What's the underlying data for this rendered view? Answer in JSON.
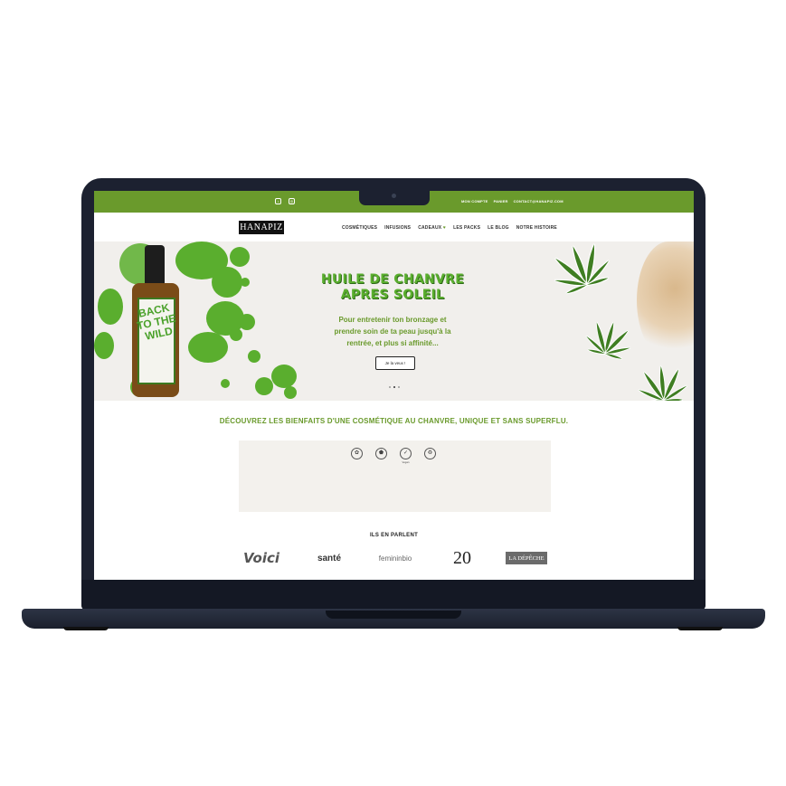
{
  "topbar": {
    "social_icons": [
      "tiktok-icon",
      "instagram-icon"
    ],
    "promo_text": "",
    "links": [
      "MON COMPTE",
      "PANIER",
      "CONTACT@HANAPIZ.COM"
    ]
  },
  "header": {
    "logo": "HANAPIZ",
    "nav": [
      "COSMÉTIQUES",
      "INFUSIONS",
      "CADEAUX",
      "LES PACKS",
      "LE BLOG",
      "NOTRE HISTOIRE"
    ]
  },
  "hero": {
    "title": "HUILE DE CHANVRE APRES SOLEIL",
    "subtitle": "Pour entretenir ton bronzage et prendre soin de ta peau jusqu'à la rentrée, et plus si affinité...",
    "cta": "Je la veux !",
    "bottle_label": "BACK TO THE WILD",
    "slides_count": 3,
    "active_slide": 2
  },
  "intro": {
    "title": "DÉCOUVREZ LES BIENFAITS D'UNE COSMÉTIQUE AU CHANVRE, UNIQUE ET SANS SUPERFLU.",
    "badges": [
      {
        "icon": "cosmos-organic-icon",
        "label": ""
      },
      {
        "icon": "france-map-icon",
        "label": ""
      },
      {
        "icon": "vegan-icon",
        "label": "Vegan"
      },
      {
        "icon": "recycle-icon",
        "label": ""
      }
    ],
    "paragraph_1": "",
    "paragraph_2": ""
  },
  "press": {
    "title": "ILS EN PARLENT",
    "logos": [
      "Voici",
      "santé",
      "femininbio",
      "20",
      "LA DÉPÊCHE"
    ]
  },
  "colors": {
    "brand_green": "#6a9a2c",
    "hero_green": "#5aae2e",
    "laptop_body": "#1c2130"
  }
}
